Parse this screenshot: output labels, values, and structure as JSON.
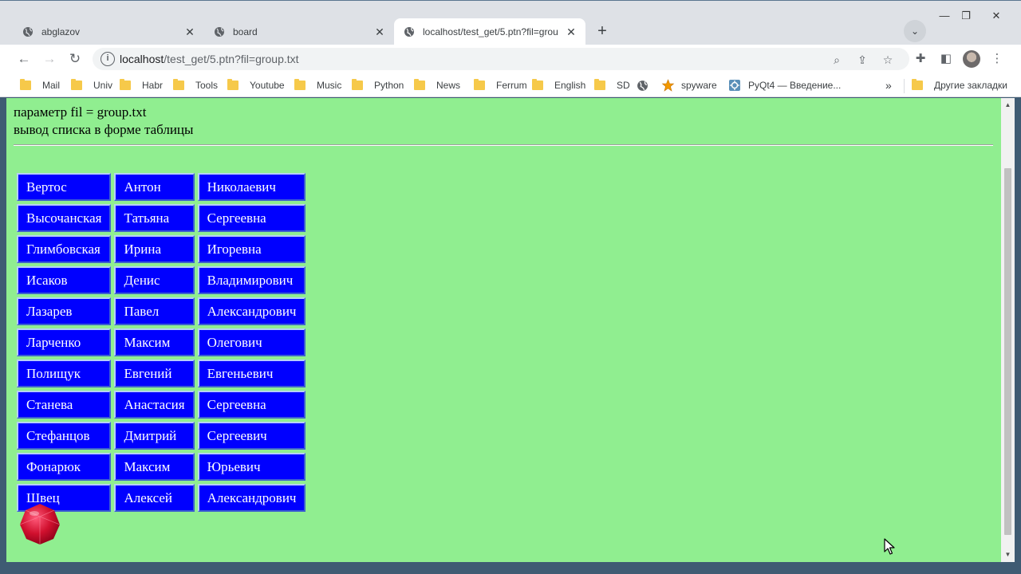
{
  "tabs": [
    {
      "title": "abglazov",
      "active": false
    },
    {
      "title": "board",
      "active": false
    },
    {
      "title": "localhost/test_get/5.ptn?fil=grou",
      "active": true
    }
  ],
  "toolbar": {
    "url_host": "localhost",
    "url_path": "/test_get/5.ptn?fil=group.txt"
  },
  "bookmarks": [
    {
      "label": "Mail",
      "icon": "folder-icon"
    },
    {
      "label": "Univ",
      "icon": "folder-icon"
    },
    {
      "label": "Habr",
      "icon": "folder-icon"
    },
    {
      "label": "Tools",
      "icon": "folder-icon"
    },
    {
      "label": "Youtube",
      "icon": "folder-icon"
    },
    {
      "label": "Music",
      "icon": "folder-icon"
    },
    {
      "label": "Python",
      "icon": "folder-icon"
    },
    {
      "label": "News",
      "icon": "folder-icon"
    },
    {
      "label": "Ferrum",
      "icon": "folder-icon"
    },
    {
      "label": "English",
      "icon": "folder-icon"
    },
    {
      "label": "SD",
      "icon": "folder-icon"
    },
    {
      "label": "",
      "icon": "globe-icon"
    },
    {
      "label": "spyware",
      "icon": "star-icon"
    },
    {
      "label": "PyQt4 — Введение...",
      "icon": "pyqt-icon"
    }
  ],
  "bookmarks_other": "Другие закладки",
  "page": {
    "param_line": "параметр fil = group.txt",
    "subtitle": "вывод списка в форме таблицы",
    "background_color": "#90ee90",
    "cell_color": "#0000ff",
    "rows": [
      [
        "Вертос",
        "Антон",
        "Николаевич"
      ],
      [
        "Высочанская",
        "Татьяна",
        "Сергеевна"
      ],
      [
        "Глимбовская",
        "Ирина",
        "Игоревна"
      ],
      [
        "Исаков",
        "Денис",
        "Владимирович"
      ],
      [
        "Лазарев",
        "Павел",
        "Александрович"
      ],
      [
        "Ларченко",
        "Максим",
        "Олегович"
      ],
      [
        "Полищук",
        "Евгений",
        "Евгеньевич"
      ],
      [
        "Станева",
        "Анастасия",
        "Сергеевна"
      ],
      [
        "Стефанцов",
        "Дмитрий",
        "Сергеевич"
      ],
      [
        "Фонарюк",
        "Максим",
        "Юрьевич"
      ],
      [
        "Швец",
        "Алексей",
        "Александрович"
      ]
    ]
  }
}
